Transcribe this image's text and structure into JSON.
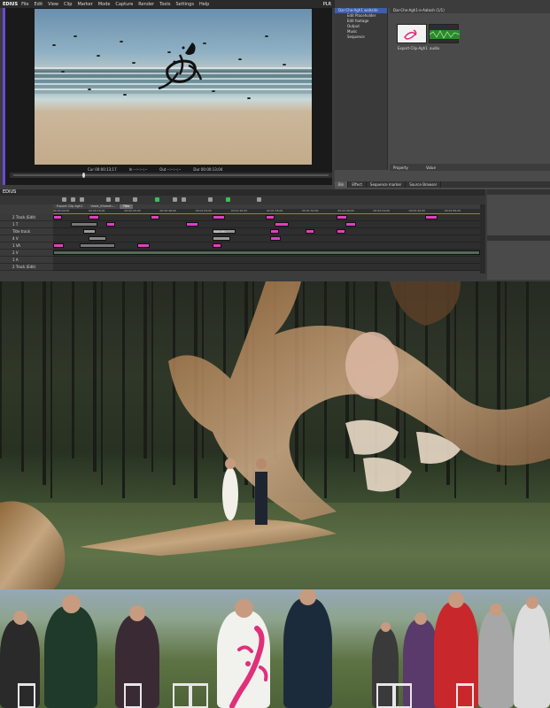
{
  "menubar": {
    "logo": "EDIUS",
    "items": [
      "File",
      "Edit",
      "View",
      "Clip",
      "Marker",
      "Mode",
      "Capture",
      "Render",
      "Tools",
      "Settings",
      "Help"
    ],
    "player_label": "PLR"
  },
  "player": {
    "timecode_cur": "Cur 00:00:13;17",
    "in_label": "In --:--:--;--",
    "out_label": "Out --:--:--;--",
    "dur_label": "Dur 00:00:13;04",
    "scrub_fraction": 0.22
  },
  "bin": {
    "header": "Dar-Che-Agh1-e-Aatash (1/1)",
    "folders": [
      {
        "label": "Dar-Che-Agh1 website",
        "selected": true,
        "indent": false
      },
      {
        "label": "Edit Placeholder",
        "selected": false,
        "indent": true
      },
      {
        "label": "Edit footage",
        "selected": false,
        "indent": true
      },
      {
        "label": "Output",
        "selected": false,
        "indent": true
      },
      {
        "label": "Music",
        "selected": false,
        "indent": true
      },
      {
        "label": "Sequence",
        "selected": false,
        "indent": true
      }
    ],
    "clips": [
      {
        "name": "Export-Clip-Agh1",
        "kind": "video"
      },
      {
        "name": "audio",
        "kind": "audio"
      }
    ],
    "prop_labels": [
      "Property",
      "Value"
    ],
    "tabs": [
      {
        "label": "Bin",
        "active": true
      },
      {
        "label": "Effect",
        "active": false
      },
      {
        "label": "Sequence marker",
        "active": false
      },
      {
        "label": "Source Browser",
        "active": false
      }
    ]
  },
  "timeline": {
    "title": "EDIUS",
    "sequence_tabs": [
      {
        "label": "Export Clip Agh1",
        "active": false
      },
      {
        "label": "Vasle_Khaneh...",
        "active": false
      },
      {
        "label": "Title",
        "active": true
      }
    ],
    "ruler_ticks": [
      "00:00:00;00",
      "00:00:16;00",
      "00:00:32;00",
      "00:00:48;00",
      "00:01:04;00",
      "00:01:20;00",
      "00:01:36;00",
      "00:01:52;00",
      "00:02:08;00",
      "00:02:24;00",
      "00:02:40;00",
      "00:02:56;00"
    ],
    "tracks": [
      {
        "name": "2 Track (Edit)",
        "clip_label": ""
      },
      {
        "name": "1 T",
        "clip_label": ""
      },
      {
        "name": "Title track",
        "clip_label": "Vasle Kh..."
      },
      {
        "name": "4 V",
        "clip_label": ""
      },
      {
        "name": "1 VA",
        "clip_label": ""
      },
      {
        "name": "2 V",
        "clip_label": "Vasle..."
      },
      {
        "name": "1 A",
        "clip_label": ""
      },
      {
        "name": "2 Track (Edit)",
        "clip_label": ""
      }
    ]
  },
  "colors": {
    "accent_purple": "#6b4ad0",
    "clip_pink": "#e040c0",
    "clip_green": "#3a8a3a",
    "selection_blue": "#3d5fa8",
    "ruler_orange": "#e06020",
    "calligraphy_pink": "#e0307a"
  }
}
